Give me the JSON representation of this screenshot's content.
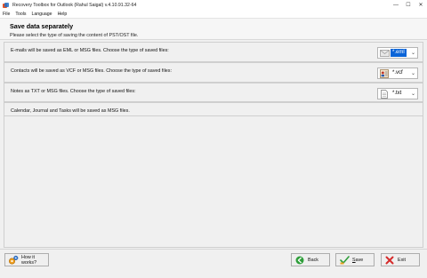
{
  "window": {
    "title": "Recovery Toolbox for Outlook (Rahul Saigal) v.4.10.91.32-64",
    "minimize_glyph": "—",
    "maximize_glyph": "☐",
    "close_glyph": "✕"
  },
  "menu": [
    "File",
    "Tools",
    "Language",
    "Help"
  ],
  "header": {
    "title": "Save data separately",
    "subtitle": "Please select the type of saving the content of PST/OST file."
  },
  "rows": [
    {
      "label": "E-mails will be saved as EML or MSG files. Choose the type of saved files:",
      "value": "*.eml",
      "icon": "envelope-icon"
    },
    {
      "label": "Contacts will be saved as VCF or MSG files. Choose the type of saved files:",
      "value": "*.vcf",
      "icon": "contact-card-icon"
    },
    {
      "label": "Notes as TXT or MSG files. Choose the type of saved files:",
      "value": "*.txt",
      "icon": "text-file-icon"
    },
    {
      "label": "Calendar, Journal and Tasks will be saved as MSG files."
    }
  ],
  "buttons": {
    "how": "How it works?",
    "back": "Back",
    "save_prefix": "S",
    "save_rest": "ave",
    "exit": "Exit"
  },
  "colors": {
    "selection": "#0a64d8",
    "exit_red": "#d52b2b",
    "back_green": "#2e9e3a",
    "save_orange": "#e9a21f"
  }
}
